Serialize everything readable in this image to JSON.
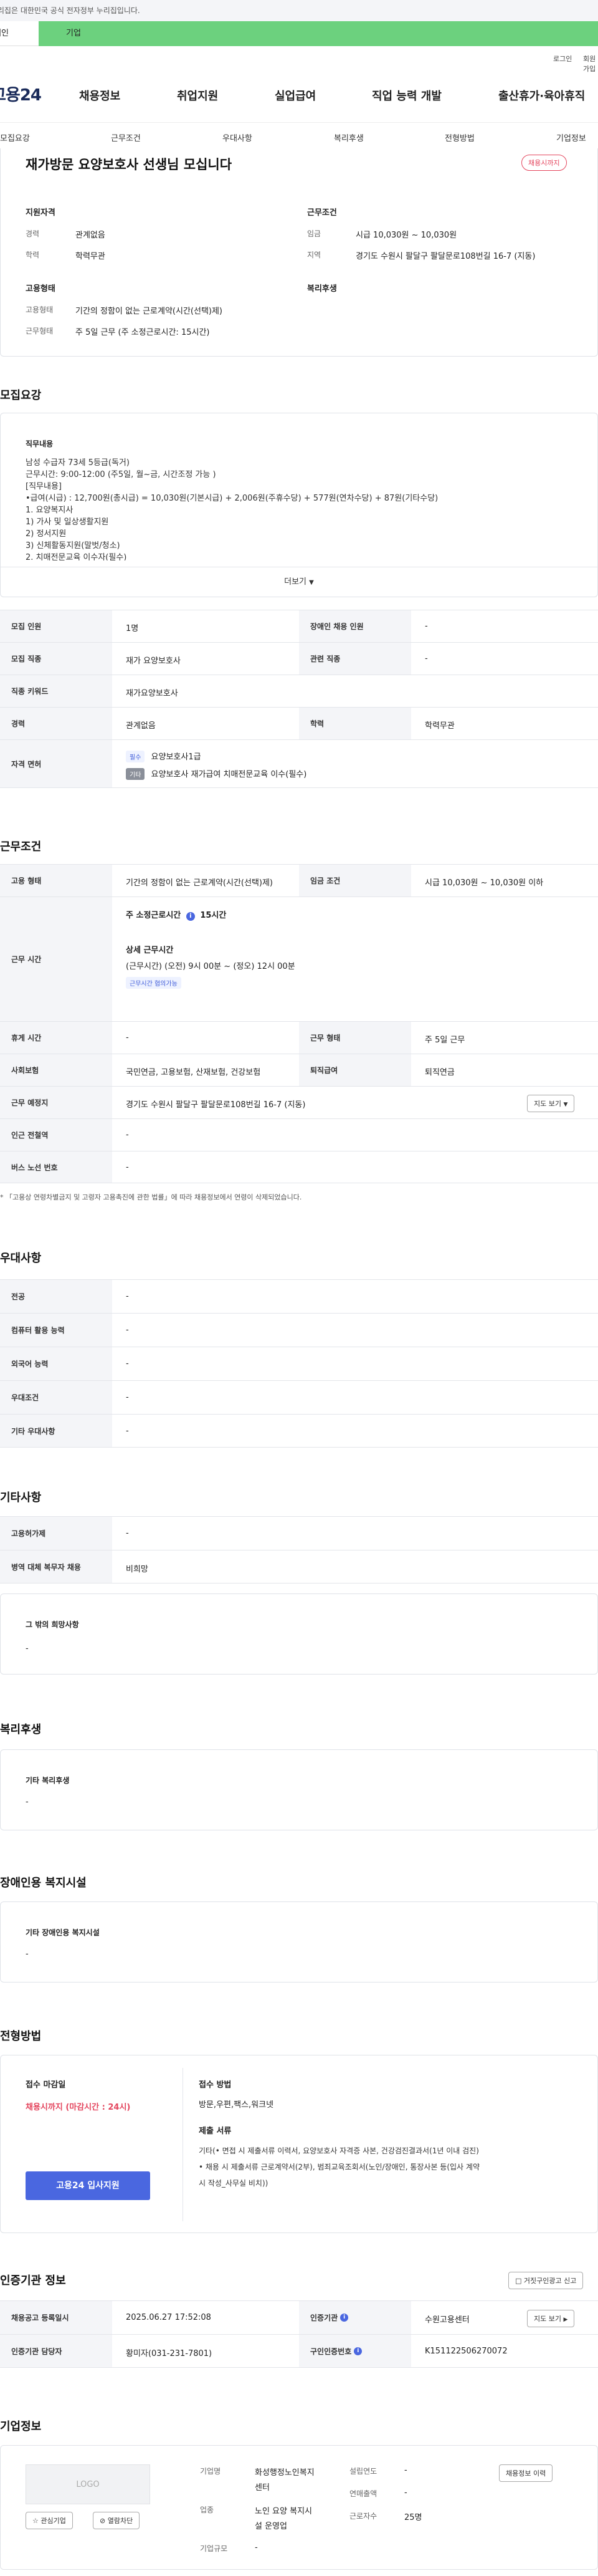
{
  "gov_notice": "이 누리집은 대한민국 공식 전자정부 누리집입니다.",
  "tabs": {
    "individual": "개인",
    "corporate": "기업"
  },
  "util": {
    "login": "로그인",
    "signup": "회원가입"
  },
  "logo": "고용24",
  "gnb": [
    "채용정보",
    "취업지원",
    "실업급여",
    "직업 능력 개발",
    "출산휴가·육아휴직"
  ],
  "subnav": [
    "모집요강",
    "근무조건",
    "우대사항",
    "복리후생",
    "전형방법",
    "기업정보"
  ],
  "summary": {
    "title": "재가방문 요양보호사 선생님 모십니다",
    "badge": "채용시까지",
    "qual_title": "지원자격",
    "career_label": "경력",
    "career_value": "관계없음",
    "edu_label": "학력",
    "edu_value": "학력무관",
    "cond_title": "근무조건",
    "wage_label": "임금",
    "wage_value": "시급 10,030원 ~ 10,030원",
    "region_label": "지역",
    "region_value": "경기도 수원시 팔달구 팔달문로108번길 16-7 (지동)",
    "emp_title": "고용형태",
    "emptype_label": "고용형태",
    "emptype_value": "기간의 정함이 없는 근로계약(시간(선택)제)",
    "worktype_label": "근무형태",
    "worktype_value": "주 5일 근무 (주 소정근로시간: 15시간)",
    "welfare_title": "복리후생"
  },
  "recruit": {
    "section_title": "모집요강",
    "job_title": "직무내용",
    "lines": [
      "남성 수급자 73세 5등급(독거)",
      "근무시간: 9:00-12:00 (주5일, 월~금, 시간조정 가능 )",
      "[직무내용]",
      "•급여(시급) : 12,700원(총시급) = 10,030원(기본시급) + 2,006원(주휴수당) + 577원(연차수당) + 87원(기타수당)",
      "1. 요양복지사",
      " 1) 가사 및 일상생활지원",
      " 2) 정서지원",
      " 3) 신체활동지원(말벗/청소)",
      "2. 치매전문교육 이수자(필수)"
    ],
    "more": "더보기",
    "rows": {
      "count_label": "모집 인원",
      "count_value": "1명",
      "disabled_label": "장애인 채용 인원",
      "disabled_value": "-",
      "job_label": "모집 직종",
      "job_value": "재가 요양보호사",
      "related_label": "관련 직종",
      "related_value": "-",
      "kw_label": "직종 키워드",
      "kw_value": "재가요양보호사",
      "career_label": "경력",
      "career_value": "관계없음",
      "edu_label": "학력",
      "edu_value": "학력무관",
      "license_label": "자격 면허",
      "license1_tag": "필수",
      "license1": "요양보호사1급",
      "license2_tag": "기타",
      "license2": "요양보호사 재가급여 치매전문교육 이수(필수)"
    }
  },
  "conditions": {
    "section_title": "근무조건",
    "emptype_label": "고용 형태",
    "emptype_value": "기간의 정함이 없는 근로계약(시간(선택)제)",
    "wage_label": "임금 조건",
    "wage_value": "시급 10,030원 ~ 10,030원 이하",
    "time_label": "근무 시간",
    "weekly_hours_label": "주 소정근로시간",
    "weekly_hours_value": "15시간",
    "detail_label": "상세 근무시간",
    "detail_value": "(근무시간) (오전) 9시 00분 ~ (정오) 12시 00분",
    "flex_tag": "근무시간 협의가능",
    "holiday_label": "휴게 시간",
    "holiday_value": "-",
    "worktype_label": "근무 형태",
    "worktype_value": "주 5일 근무",
    "insurance_label": "사회보험",
    "insurance_value": "국민연금, 고용보험, 산재보험, 건강보험",
    "retire_label": "퇴직급여",
    "retire_value": "퇴직연금",
    "location_label": "근무 예정지",
    "location_value": "경기도 수원시 팔달구 팔달문로108번길 16-7 (지동)",
    "map_btn": "지도 보기",
    "station_label": "인근 전철역",
    "station_value": "-",
    "bus_label": "버스 노선 번호",
    "bus_value": "-",
    "note": "* 「고용상 연령차별금지 및 고령자 고용촉진에 관한 법률」에 따라 채용정보에서 연령이 삭제되었습니다."
  },
  "preferences": {
    "section_title": "우대사항",
    "rows": [
      {
        "label": "전공",
        "value": "-"
      },
      {
        "label": "컴퓨터 활용 능력",
        "value": "-"
      },
      {
        "label": "외국어 능력",
        "value": "-"
      },
      {
        "label": "우대조건",
        "value": "-"
      },
      {
        "label": "기타 우대사항",
        "value": "-"
      }
    ]
  },
  "other": {
    "section_title": "기타사항",
    "employ_label": "고용허가제",
    "employ_value": "-",
    "military_label": "병역 대체 복무자 채용",
    "military_value": "비희망",
    "hope_title": "그 밖의 희망사항",
    "hope_value": "-"
  },
  "welfare": {
    "section_title": "복리후생",
    "box_title": "기타 복리후생",
    "box_value": "-"
  },
  "disabled": {
    "section_title": "장애인용 복지시설",
    "box_title": "기타 장애인용 복지시설",
    "box_value": "-"
  },
  "selection": {
    "section_title": "전형방법",
    "deadline_title": "접수 마감일",
    "deadline_value": "채용시까지 (마감시간 : 24시)",
    "apply_btn": "고용24 입사지원",
    "method_title": "접수 방법",
    "method_value": "방문,우편,팩스,워크넷",
    "docs_title": "제출 서류",
    "docs_line1": "기타(• 면접 시 제출서류    이력서, 요양보호사 자격증 사본, 건강검진결과서(1년 이내 검진)",
    "docs_line2": "• 채용 시 제출서류    근로계약서(2부), 범죄교육조회서(노인/장애인, 통장사본 등(입사 계약",
    "docs_line3": "시 작성_사무실 비치))"
  },
  "certification": {
    "section_title": "인증기관 정보",
    "report_btn": "거짓구인광고 신고",
    "reg_label": "채용공고 등록일시",
    "reg_value": "2025.06.27 17:52:08",
    "org_label": "인증기관",
    "org_value": "수원고용센터",
    "map_btn": "지도 보기",
    "manager_label": "인증기관 담당자",
    "manager_value": "황미자(031-231-7801)",
    "num_label": "구인인증번호",
    "num_value": "K151122506270072"
  },
  "company": {
    "section_title": "기업정보",
    "logo_text": "LOGO",
    "fav_btn": "관심기업",
    "block_btn": "열람차단",
    "name_label": "기업명",
    "name_value1": "화성행정노인복지",
    "name_value2": "센터",
    "industry_label": "업종",
    "industry_value1": "노인 요양 복지시",
    "industry_value2": "설 운영업",
    "size_label": "기업규모",
    "size_value": "-",
    "founded_label": "설립연도",
    "founded_value": "-",
    "sales_label": "연매출액",
    "sales_value": "-",
    "employees_label": "근로자수",
    "employees_value": "25명",
    "list_btn": "채용정보 이력"
  }
}
